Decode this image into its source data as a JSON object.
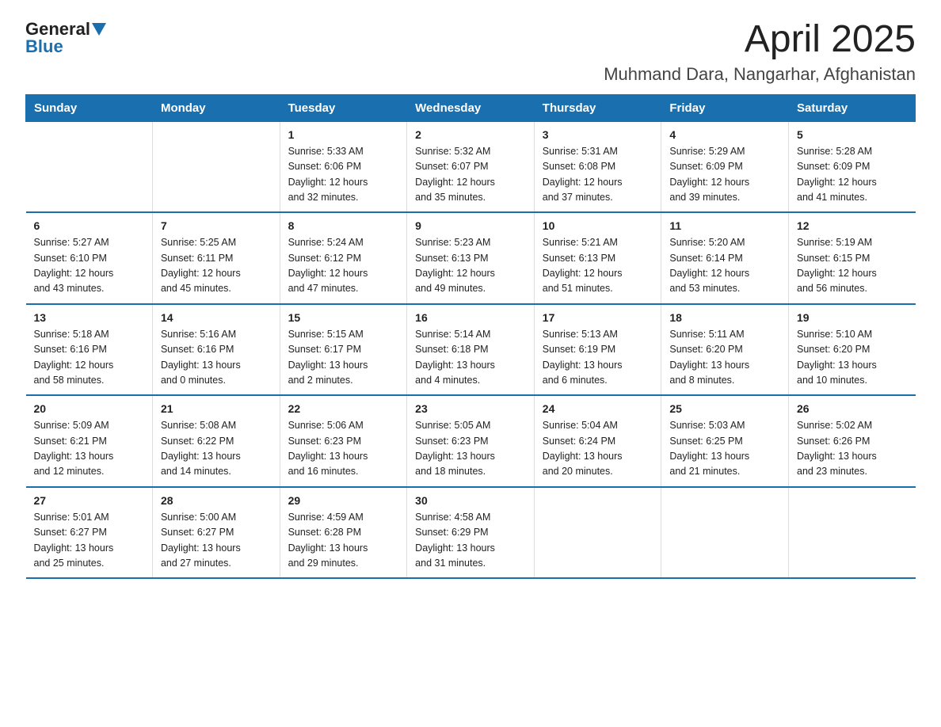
{
  "header": {
    "logo_general": "General",
    "logo_blue": "Blue",
    "title": "April 2025",
    "subtitle": "Muhmand Dara, Nangarhar, Afghanistan"
  },
  "calendar": {
    "days_of_week": [
      "Sunday",
      "Monday",
      "Tuesday",
      "Wednesday",
      "Thursday",
      "Friday",
      "Saturday"
    ],
    "weeks": [
      [
        {
          "day": "",
          "info": ""
        },
        {
          "day": "",
          "info": ""
        },
        {
          "day": "1",
          "info": "Sunrise: 5:33 AM\nSunset: 6:06 PM\nDaylight: 12 hours\nand 32 minutes."
        },
        {
          "day": "2",
          "info": "Sunrise: 5:32 AM\nSunset: 6:07 PM\nDaylight: 12 hours\nand 35 minutes."
        },
        {
          "day": "3",
          "info": "Sunrise: 5:31 AM\nSunset: 6:08 PM\nDaylight: 12 hours\nand 37 minutes."
        },
        {
          "day": "4",
          "info": "Sunrise: 5:29 AM\nSunset: 6:09 PM\nDaylight: 12 hours\nand 39 minutes."
        },
        {
          "day": "5",
          "info": "Sunrise: 5:28 AM\nSunset: 6:09 PM\nDaylight: 12 hours\nand 41 minutes."
        }
      ],
      [
        {
          "day": "6",
          "info": "Sunrise: 5:27 AM\nSunset: 6:10 PM\nDaylight: 12 hours\nand 43 minutes."
        },
        {
          "day": "7",
          "info": "Sunrise: 5:25 AM\nSunset: 6:11 PM\nDaylight: 12 hours\nand 45 minutes."
        },
        {
          "day": "8",
          "info": "Sunrise: 5:24 AM\nSunset: 6:12 PM\nDaylight: 12 hours\nand 47 minutes."
        },
        {
          "day": "9",
          "info": "Sunrise: 5:23 AM\nSunset: 6:13 PM\nDaylight: 12 hours\nand 49 minutes."
        },
        {
          "day": "10",
          "info": "Sunrise: 5:21 AM\nSunset: 6:13 PM\nDaylight: 12 hours\nand 51 minutes."
        },
        {
          "day": "11",
          "info": "Sunrise: 5:20 AM\nSunset: 6:14 PM\nDaylight: 12 hours\nand 53 minutes."
        },
        {
          "day": "12",
          "info": "Sunrise: 5:19 AM\nSunset: 6:15 PM\nDaylight: 12 hours\nand 56 minutes."
        }
      ],
      [
        {
          "day": "13",
          "info": "Sunrise: 5:18 AM\nSunset: 6:16 PM\nDaylight: 12 hours\nand 58 minutes."
        },
        {
          "day": "14",
          "info": "Sunrise: 5:16 AM\nSunset: 6:16 PM\nDaylight: 13 hours\nand 0 minutes."
        },
        {
          "day": "15",
          "info": "Sunrise: 5:15 AM\nSunset: 6:17 PM\nDaylight: 13 hours\nand 2 minutes."
        },
        {
          "day": "16",
          "info": "Sunrise: 5:14 AM\nSunset: 6:18 PM\nDaylight: 13 hours\nand 4 minutes."
        },
        {
          "day": "17",
          "info": "Sunrise: 5:13 AM\nSunset: 6:19 PM\nDaylight: 13 hours\nand 6 minutes."
        },
        {
          "day": "18",
          "info": "Sunrise: 5:11 AM\nSunset: 6:20 PM\nDaylight: 13 hours\nand 8 minutes."
        },
        {
          "day": "19",
          "info": "Sunrise: 5:10 AM\nSunset: 6:20 PM\nDaylight: 13 hours\nand 10 minutes."
        }
      ],
      [
        {
          "day": "20",
          "info": "Sunrise: 5:09 AM\nSunset: 6:21 PM\nDaylight: 13 hours\nand 12 minutes."
        },
        {
          "day": "21",
          "info": "Sunrise: 5:08 AM\nSunset: 6:22 PM\nDaylight: 13 hours\nand 14 minutes."
        },
        {
          "day": "22",
          "info": "Sunrise: 5:06 AM\nSunset: 6:23 PM\nDaylight: 13 hours\nand 16 minutes."
        },
        {
          "day": "23",
          "info": "Sunrise: 5:05 AM\nSunset: 6:23 PM\nDaylight: 13 hours\nand 18 minutes."
        },
        {
          "day": "24",
          "info": "Sunrise: 5:04 AM\nSunset: 6:24 PM\nDaylight: 13 hours\nand 20 minutes."
        },
        {
          "day": "25",
          "info": "Sunrise: 5:03 AM\nSunset: 6:25 PM\nDaylight: 13 hours\nand 21 minutes."
        },
        {
          "day": "26",
          "info": "Sunrise: 5:02 AM\nSunset: 6:26 PM\nDaylight: 13 hours\nand 23 minutes."
        }
      ],
      [
        {
          "day": "27",
          "info": "Sunrise: 5:01 AM\nSunset: 6:27 PM\nDaylight: 13 hours\nand 25 minutes."
        },
        {
          "day": "28",
          "info": "Sunrise: 5:00 AM\nSunset: 6:27 PM\nDaylight: 13 hours\nand 27 minutes."
        },
        {
          "day": "29",
          "info": "Sunrise: 4:59 AM\nSunset: 6:28 PM\nDaylight: 13 hours\nand 29 minutes."
        },
        {
          "day": "30",
          "info": "Sunrise: 4:58 AM\nSunset: 6:29 PM\nDaylight: 13 hours\nand 31 minutes."
        },
        {
          "day": "",
          "info": ""
        },
        {
          "day": "",
          "info": ""
        },
        {
          "day": "",
          "info": ""
        }
      ]
    ]
  }
}
